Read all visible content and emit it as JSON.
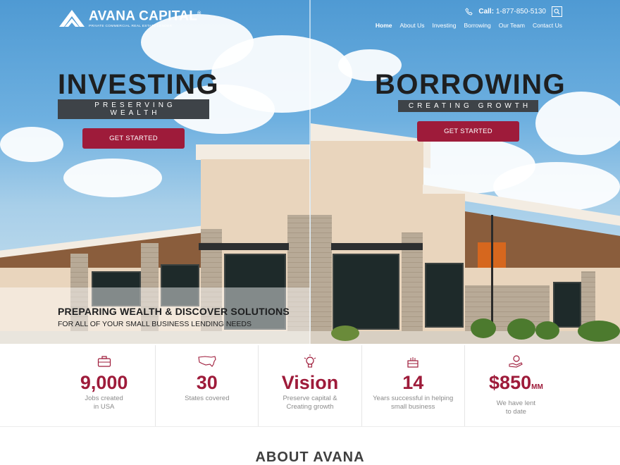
{
  "brand": {
    "name": "AVANA CAPITAL",
    "tagline": "PRIVATE COMMERCIAL REAL ESTATE LENDER",
    "registered": "®"
  },
  "contact": {
    "call_label": "Call:",
    "phone": "1-877-850-5130"
  },
  "icons": {
    "phone": "phone-icon",
    "search": "search-icon"
  },
  "nav": [
    "Home",
    "About Us",
    "Investing",
    "Borrowing",
    "Our Team",
    "Contact Us"
  ],
  "hero": {
    "left": {
      "title": "INVESTING",
      "subtitle": "PRESERVING WEALTH",
      "cta": "GET STARTED"
    },
    "right": {
      "title": "BORROWING",
      "subtitle": "CREATING GROWTH",
      "cta": "GET STARTED"
    },
    "overlay_title": "PREPARING WEALTH & DISCOVER SOLUTIONS",
    "overlay_sub": "FOR ALL OF YOUR SMALL BUSINESS LENDING NEEDS"
  },
  "stats": [
    {
      "icon": "briefcase-icon",
      "value": "9,000",
      "unit": "",
      "desc": "Jobs created\nin USA"
    },
    {
      "icon": "usa-map-icon",
      "value": "30",
      "unit": "",
      "desc": "States covered"
    },
    {
      "icon": "lightbulb-icon",
      "value": "Vision",
      "unit": "",
      "desc": "Preserve capital &\nCreating growth"
    },
    {
      "icon": "cake-icon",
      "value": "14",
      "unit": "",
      "desc": "Years successful in helping\nsmall business"
    },
    {
      "icon": "money-hand-icon",
      "value": "$850",
      "unit": "MM",
      "desc": "We have lent\nto date"
    }
  ],
  "about_heading": "ABOUT AVANA",
  "colors": {
    "accent": "#9e1b3a",
    "dark": "#1e1f20",
    "subtitle_bar": "#3e4348"
  }
}
